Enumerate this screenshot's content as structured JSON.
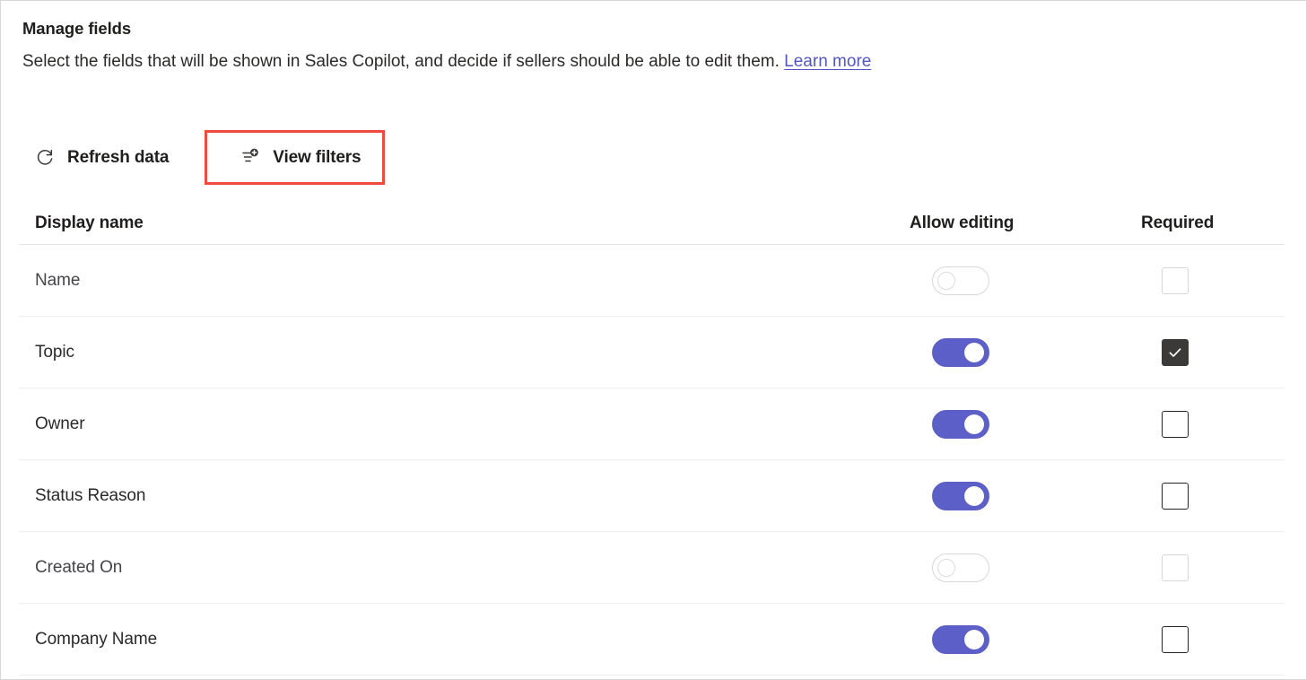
{
  "header": {
    "title": "Manage fields",
    "subtitle_text": "Select the fields that will be shown in Sales Copilot, and decide if sellers should be able to edit them.",
    "link_label": "Learn more"
  },
  "toolbar": {
    "refresh_label": "Refresh data",
    "view_filters_label": "View filters",
    "annotation_color": "#f04a3f"
  },
  "table": {
    "columns": {
      "display_name": "Display name",
      "allow_editing": "Allow editing",
      "required": "Required"
    },
    "rows": [
      {
        "name": "Name",
        "allow_editing": "off",
        "editing_disabled": true,
        "required": "unchecked",
        "required_disabled": true
      },
      {
        "name": "Topic",
        "allow_editing": "on",
        "editing_disabled": false,
        "required": "checked",
        "required_disabled": false
      },
      {
        "name": "Owner",
        "allow_editing": "on",
        "editing_disabled": false,
        "required": "unchecked",
        "required_disabled": false
      },
      {
        "name": "Status Reason",
        "allow_editing": "on",
        "editing_disabled": false,
        "required": "unchecked",
        "required_disabled": false
      },
      {
        "name": "Created On",
        "allow_editing": "off",
        "editing_disabled": true,
        "required": "unchecked",
        "required_disabled": true
      },
      {
        "name": "Company Name",
        "allow_editing": "on",
        "editing_disabled": false,
        "required": "unchecked",
        "required_disabled": false
      }
    ]
  },
  "theme": {
    "toggle_on_color": "#5b5fc7",
    "checkbox_checked_color": "#3b3a39",
    "link_color": "#5356c4",
    "text_color": "#2b2a29"
  },
  "icons": {
    "refresh": "refresh-icon",
    "view_filters": "filter-add-icon",
    "checkmark": "checkmark-icon"
  }
}
